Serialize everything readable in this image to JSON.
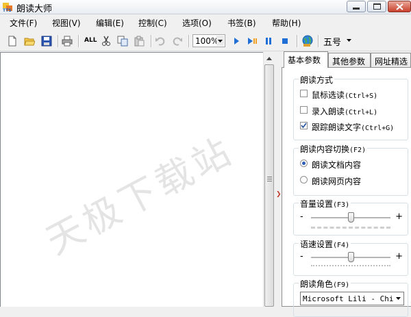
{
  "window": {
    "title": "朗读大师"
  },
  "menu": [
    "文件(F)",
    "视图(V)",
    "编辑(E)",
    "控制(C)",
    "选项(O)",
    "书签(B)",
    "帮助(H)"
  ],
  "toolbar": {
    "zoom_value": "100%",
    "all_label": "ALL",
    "font_size": "五号"
  },
  "watermark": "天极下载站",
  "tabs": [
    "基本参数",
    "其他参数",
    "网址精选"
  ],
  "read_mode": {
    "title": "朗读方式",
    "options": [
      {
        "label": "鼠标选读",
        "shortcut": "(Ctrl+S)",
        "checked": false
      },
      {
        "label": "录入朗读",
        "shortcut": "(Ctrl+L)",
        "checked": false
      },
      {
        "label": "跟踪朗读文字",
        "shortcut": "(Ctrl+G)",
        "checked": true
      }
    ]
  },
  "content_switch": {
    "title": "朗读内容切换",
    "shortcut": "(F2)",
    "options": [
      {
        "label": "朗读文档内容",
        "selected": true
      },
      {
        "label": "朗读网页内容",
        "selected": false
      }
    ]
  },
  "volume": {
    "title": "音量设置",
    "shortcut": "(F3)",
    "minus": "-",
    "plus": "+",
    "level": 0.5
  },
  "speed": {
    "title": "语速设置",
    "shortcut": "(F4)",
    "minus": "-",
    "plus": "+",
    "level": 0.5
  },
  "voice": {
    "title": "朗读角色",
    "shortcut": "(F9)",
    "selected": "Microsoft Lili - Chi"
  }
}
